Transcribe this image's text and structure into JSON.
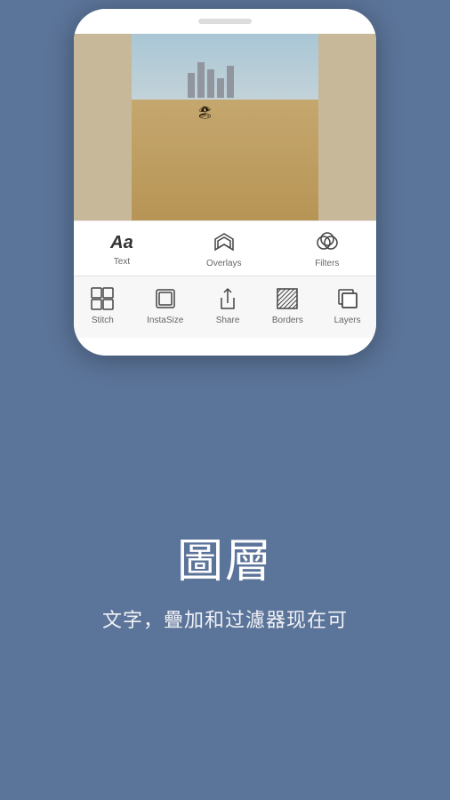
{
  "phone": {
    "toolbar_top": {
      "items": [
        {
          "id": "text",
          "label": "Text",
          "icon": "text-icon"
        },
        {
          "id": "overlays",
          "label": "Overlays",
          "icon": "overlays-icon"
        },
        {
          "id": "filters",
          "label": "Filters",
          "icon": "filters-icon"
        }
      ]
    },
    "toolbar_bottom": {
      "items": [
        {
          "id": "stitch",
          "label": "Stitch",
          "icon": "stitch-icon"
        },
        {
          "id": "instasize",
          "label": "InstaSize",
          "icon": "instasize-icon"
        },
        {
          "id": "share",
          "label": "Share",
          "icon": "share-icon"
        },
        {
          "id": "borders",
          "label": "Borders",
          "icon": "borders-icon"
        },
        {
          "id": "layers",
          "label": "Layers",
          "icon": "layers-icon"
        }
      ]
    }
  },
  "promo": {
    "title": "圖層",
    "subtitle": "文字，疊加和过濾器现在可"
  }
}
